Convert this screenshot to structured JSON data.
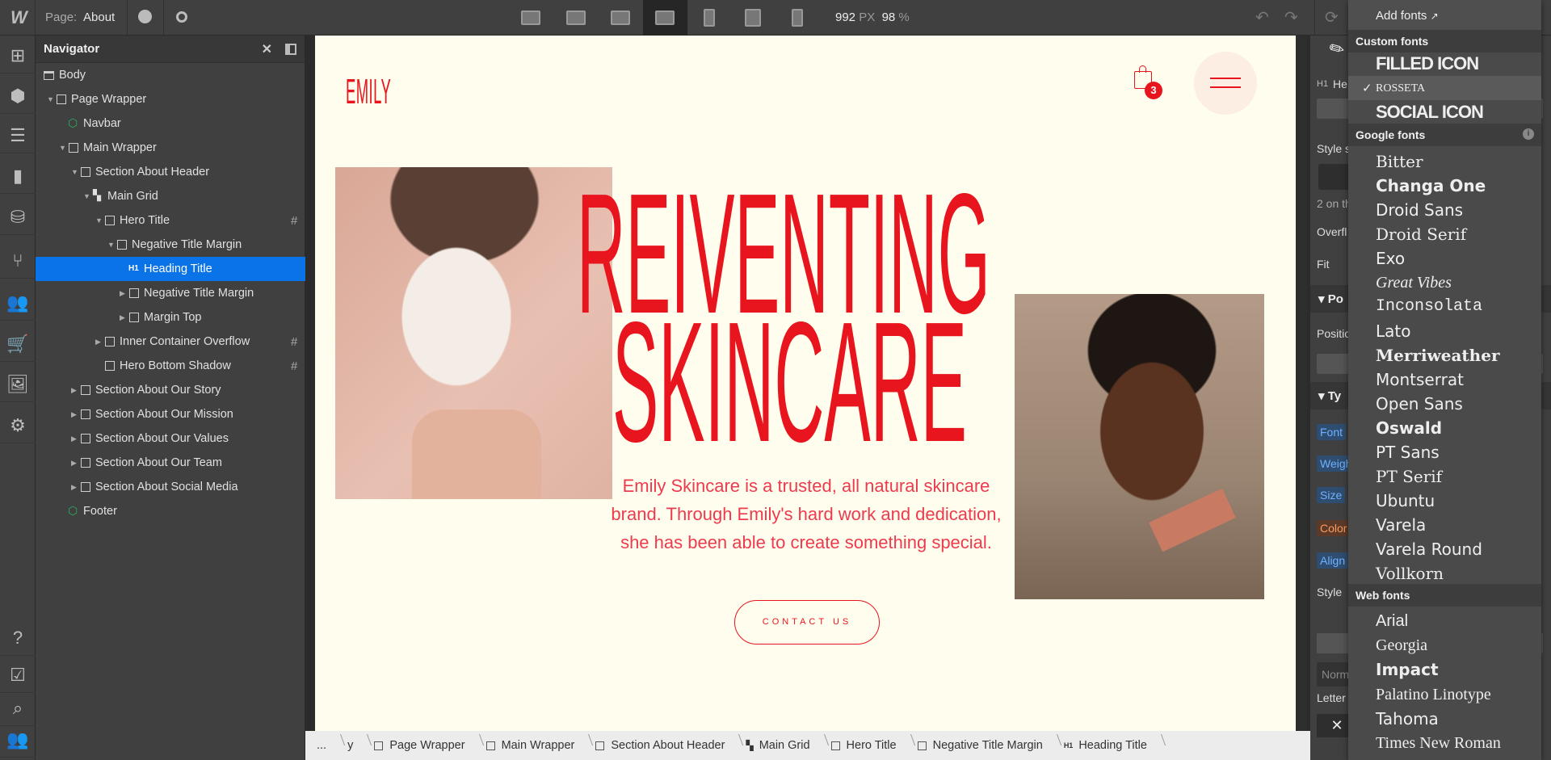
{
  "topbar": {
    "logo": "W",
    "page_label": "Page:",
    "page_name": "About",
    "width_value": "992",
    "width_unit": "PX",
    "zoom_value": "98",
    "zoom_unit": "%",
    "devices": [
      "desktop-xl-icon",
      "desktop-large-icon",
      "desktop-icon",
      "desktop-base-icon",
      "tablet-icon",
      "mobile-landscape-icon",
      "mobile-portrait-icon"
    ],
    "active_device": 3
  },
  "rail": [
    "add-icon",
    "components-icon",
    "navigator-icon",
    "pages-icon",
    "cms-icon",
    "logic-icon",
    "users-icon",
    "ecommerce-icon",
    "assets-icon",
    "settings-icon",
    "help-icon",
    "tasks-icon",
    "search-icon",
    "collaborators-icon"
  ],
  "navigator": {
    "title": "Navigator",
    "items": [
      {
        "label": "Body",
        "depth": 0,
        "icon": "body"
      },
      {
        "label": "Page Wrapper",
        "depth": 1,
        "icon": "box",
        "expanded": true
      },
      {
        "label": "Navbar",
        "depth": 2,
        "icon": "component"
      },
      {
        "label": "Main Wrapper",
        "depth": 2,
        "icon": "box",
        "expanded": true
      },
      {
        "label": "Section About Header",
        "depth": 3,
        "icon": "box",
        "expanded": true
      },
      {
        "label": "Main Grid",
        "depth": 4,
        "icon": "grid",
        "expanded": true
      },
      {
        "label": "Hero Title",
        "depth": 5,
        "icon": "box",
        "expanded": true,
        "grid": true
      },
      {
        "label": "Negative Title Margin",
        "depth": 6,
        "icon": "box",
        "expanded": true
      },
      {
        "label": "Heading Title",
        "depth": 7,
        "icon": "h1",
        "selected": true
      },
      {
        "label": "Negative Title Margin",
        "depth": 7,
        "icon": "box",
        "collapsed": true
      },
      {
        "label": "Margin Top",
        "depth": 7,
        "icon": "box",
        "collapsed": true
      },
      {
        "label": "Inner Container Overflow",
        "depth": 5,
        "icon": "box",
        "collapsed": true,
        "grid": true
      },
      {
        "label": "Hero Bottom Shadow",
        "depth": 5,
        "icon": "box",
        "grid": true
      },
      {
        "label": "Section About Our Story",
        "depth": 3,
        "icon": "box",
        "collapsed": true
      },
      {
        "label": "Section About Our Mission",
        "depth": 3,
        "icon": "box",
        "collapsed": true
      },
      {
        "label": "Section About Our Values",
        "depth": 3,
        "icon": "box",
        "collapsed": true
      },
      {
        "label": "Section About Our Team",
        "depth": 3,
        "icon": "box",
        "collapsed": true
      },
      {
        "label": "Section About Social Media",
        "depth": 3,
        "icon": "box",
        "collapsed": true
      },
      {
        "label": "Footer",
        "depth": 2,
        "icon": "component"
      }
    ]
  },
  "site": {
    "logo": "EMILY",
    "cart_count": "3",
    "title_line1": "REIVENTING",
    "title_line2": "SKINCARE",
    "paragraph_lines": [
      "Emily Skincare is a trusted, all natural skincare",
      "brand. Through Emily's hard work and dedication,",
      "she has been able to create something special."
    ],
    "cta": "CONTACT US",
    "accent": "#e8141e",
    "background": "#fffeee"
  },
  "breadcrumbs": [
    "...",
    "y",
    "Page Wrapper",
    "Main Wrapper",
    "Section About Header",
    "Main Grid",
    "Hero Title",
    "Negative Title Margin",
    "Heading Title"
  ],
  "panel": {
    "tag": "H1",
    "name_partial": "He",
    "style_sel": "Style s",
    "on_page": "2 on th",
    "overflow": "Overfl",
    "fit": "Fit",
    "position_head": "Po",
    "position": "Positio",
    "typography_head": "Ty",
    "font": "Font",
    "weight": "Weigh",
    "size": "Size",
    "color": "Color",
    "align": "Align",
    "style": "Style",
    "normal": "Norm",
    "letter": "Letter s",
    "x": "✕"
  },
  "font_dropdown": {
    "add_fonts": "Add fonts",
    "custom_header": "Custom fonts",
    "custom": [
      "FILLED ICON",
      "ROSSETA",
      "SOCIAL ICON"
    ],
    "selected": "ROSSETA",
    "google_header": "Google fonts",
    "google": [
      "Bitter",
      "Changa One",
      "Droid Sans",
      "Droid Serif",
      "Exo",
      "Great Vibes",
      "Inconsolata",
      "Lato",
      "Merriweather",
      "Montserrat",
      "Open Sans",
      "Oswald",
      "PT Sans",
      "PT Serif",
      "Ubuntu",
      "Varela",
      "Varela Round",
      "Vollkorn"
    ],
    "web_header": "Web fonts",
    "web": [
      "Arial",
      "Georgia",
      "Impact",
      "Palatino Linotype",
      "Tahoma",
      "Times New Roman"
    ]
  }
}
